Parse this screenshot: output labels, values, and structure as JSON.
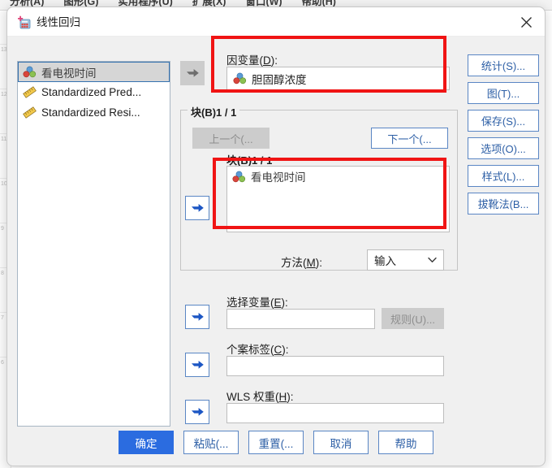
{
  "background": {
    "menu_items": [
      {
        "label": "分析(A)"
      },
      {
        "label": "图形(G)"
      },
      {
        "label": "实用程序(U)"
      },
      {
        "label": "扩展(X)"
      },
      {
        "label": "窗口(W)"
      },
      {
        "label": "帮助(H)"
      }
    ],
    "row_numbers": [
      "13",
      "12",
      "11",
      "10",
      "9",
      "8",
      "7",
      "6"
    ]
  },
  "dialog": {
    "title": "线性回归",
    "icon": "spss-linear-regression-icon",
    "close_icon": "close-icon"
  },
  "variable_list": {
    "items": [
      {
        "label": "看电视时间",
        "icon": "nominal-variable-icon",
        "selected": true,
        "lang": "cn"
      },
      {
        "label": "Standardized Pred...",
        "icon": "scale-variable-icon",
        "selected": false,
        "lang": "en"
      },
      {
        "label": "Standardized Resi...",
        "icon": "scale-variable-icon",
        "selected": false,
        "lang": "en"
      }
    ]
  },
  "dependent": {
    "label": "因变量(D):",
    "label_plain": "因变量(",
    "mnemonic": "D",
    "label_tail": "):",
    "value": "胆固醇浓度",
    "value_icon": "nominal-variable-icon",
    "move_arrow_icon": "arrow-right-icon",
    "move_arrow_enabled": false
  },
  "block": {
    "group_title": "块(B)1 / 1",
    "previous_button": "上一个(...",
    "previous_enabled": false,
    "next_button": "下一个(...",
    "next_enabled": true,
    "inner_title": "块(B)1 / 1",
    "independents": [
      {
        "label": "看电视时间",
        "icon": "nominal-variable-icon"
      }
    ],
    "move_arrow_icon": "arrow-right-icon",
    "move_arrow_enabled": true,
    "method_label_plain": "方法(",
    "method_mnemonic": "M",
    "method_label_tail": "):",
    "method_value": "输入",
    "method_chevron_icon": "chevron-down-icon"
  },
  "selection_variable": {
    "label_plain": "选择变量(",
    "mnemonic": "E",
    "label_tail": "):",
    "value": "",
    "rules_button": "规则(U)...",
    "rules_enabled": false,
    "move_arrow_icon": "arrow-right-icon"
  },
  "case_labels": {
    "label_plain": "个案标签(",
    "mnemonic": "C",
    "label_tail": "):",
    "value": "",
    "move_arrow_icon": "arrow-right-icon"
  },
  "wls_weight": {
    "label_plain": "WLS 权重(",
    "mnemonic": "H",
    "label_tail": "):",
    "value": "",
    "move_arrow_icon": "arrow-right-icon"
  },
  "side_buttons": [
    {
      "label": "统计(S)..."
    },
    {
      "label": "图(T)..."
    },
    {
      "label": "保存(S)..."
    },
    {
      "label": "选项(O)..."
    },
    {
      "label": "样式(L)..."
    },
    {
      "label": "拔靴法(B..."
    }
  ],
  "action_buttons": [
    {
      "label": "确定",
      "primary": true
    },
    {
      "label": "粘贴(...",
      "primary": false
    },
    {
      "label": "重置(...",
      "primary": false
    },
    {
      "label": "取消",
      "primary": false
    },
    {
      "label": "帮助",
      "primary": false
    }
  ],
  "annotations": {
    "color": "#f01414",
    "boxes": [
      {
        "name": "dependent-variable-highlight"
      },
      {
        "name": "independent-variables-highlight"
      }
    ]
  }
}
